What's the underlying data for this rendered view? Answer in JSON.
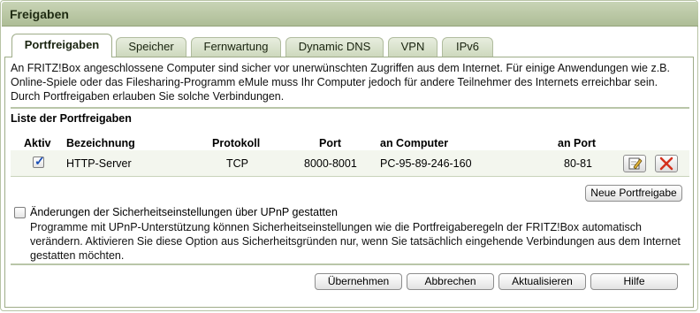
{
  "window": {
    "title": "Freigaben"
  },
  "tabs": [
    {
      "label": "Portfreigaben",
      "active": true
    },
    {
      "label": "Speicher",
      "active": false
    },
    {
      "label": "Fernwartung",
      "active": false
    },
    {
      "label": "Dynamic DNS",
      "active": false
    },
    {
      "label": "VPN",
      "active": false
    },
    {
      "label": "IPv6",
      "active": false
    }
  ],
  "intro": "An FRITZ!Box angeschlossene Computer sind sicher vor unerwünschten Zugriffen aus dem Internet. Für einige Anwendungen wie z.B. Online-Spiele oder das Filesharing-Programm eMule muss Ihr Computer jedoch für andere Teilnehmer des Internets erreichbar sein. Durch Portfreigaben erlauben Sie solche Verbindungen.",
  "list": {
    "title": "Liste der Portfreigaben",
    "columns": [
      "Aktiv",
      "Bezeichnung",
      "Protokoll",
      "Port",
      "an Computer",
      "an Port"
    ],
    "rows": [
      {
        "active": true,
        "name": "HTTP-Server",
        "protocol": "TCP",
        "port": "8000-8001",
        "computer": "PC-95-89-246-160",
        "target_port": "80-81",
        "edit_icon": "edit-icon",
        "delete_icon": "delete-icon"
      }
    ],
    "new_button": "Neue Portfreigabe"
  },
  "upnp": {
    "checked": false,
    "label": "Änderungen der Sicherheitseinstellungen über UPnP gestatten",
    "description": "Programme mit UPnP-Unterstützung können Sicherheitseinstellungen wie die Portfreigaberegeln der FRITZ!Box automatisch verändern. Aktivieren Sie diese Option aus Sicherheitsgründen nur, wenn Sie tatsächlich eingehende Verbindungen aus dem Internet gestatten möchten."
  },
  "footer": {
    "ok": "Übernehmen",
    "cancel": "Abbrechen",
    "refresh": "Aktualisieren",
    "help": "Hilfe"
  },
  "colors": {
    "title_bar": "#aebd96",
    "separator": "#b9c6a8",
    "delete_x": "#d4301c"
  }
}
